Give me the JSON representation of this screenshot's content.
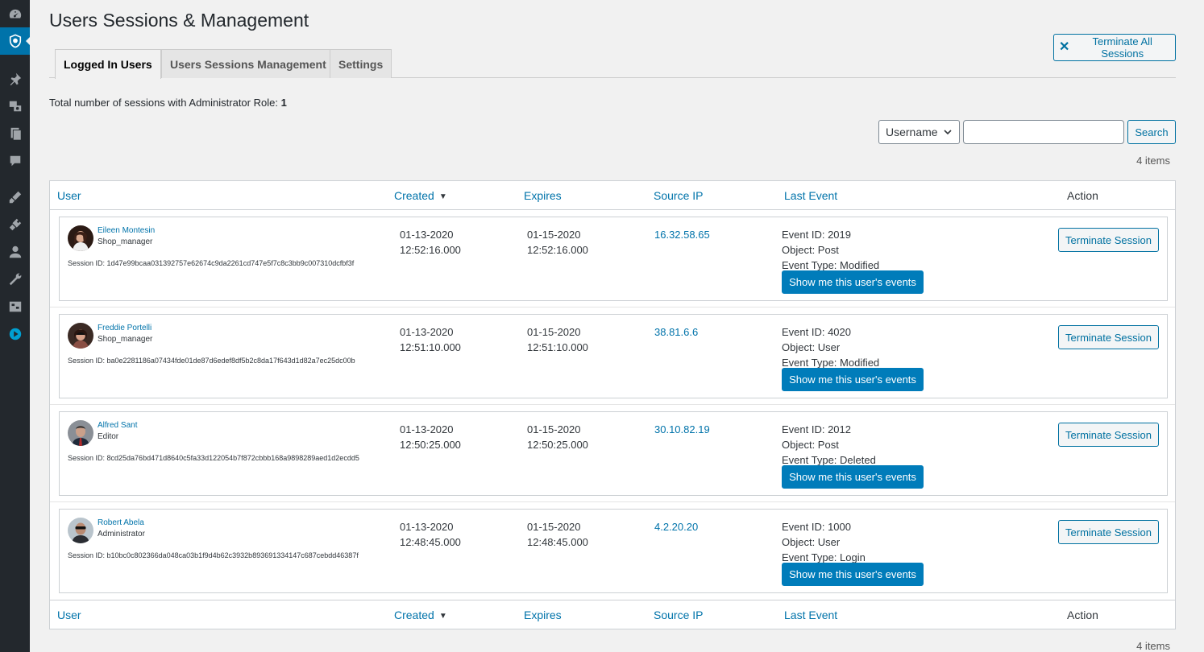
{
  "page": {
    "title": "Users Sessions & Management"
  },
  "header": {
    "terminate_all_label": "Terminate All Sessions"
  },
  "tabs": [
    {
      "label": "Logged In Users",
      "active": true
    },
    {
      "label": "Users Sessions Management",
      "active": false
    },
    {
      "label": "Settings",
      "active": false
    }
  ],
  "summary": {
    "label": "Total number of sessions with Administrator Role:",
    "count": "1"
  },
  "search": {
    "field_selected": "Username",
    "value": "",
    "button_label": "Search"
  },
  "items_count": "4 items",
  "columns": {
    "user": "User",
    "created": "Created",
    "expires": "Expires",
    "source_ip": "Source IP",
    "last_event": "Last Event",
    "action": "Action"
  },
  "rows": [
    {
      "name": "Eileen Montesin",
      "role": "Shop_manager",
      "session": "Session ID: 1d47e99bcaa031392757e62674c9da2261cd747e5f7c8c3bb9c007310dcfbf3f",
      "created_date": "01-13-2020",
      "created_time": "12:52:16.000",
      "expires_date": "01-15-2020",
      "expires_time": "12:52:16.000",
      "ip": "16.32.58.65",
      "event_id": "Event ID: 2019",
      "object": "Object: Post",
      "event_type": "Event Type: Modified",
      "events_button": "Show me this user's events",
      "terminate_button": "Terminate Session"
    },
    {
      "name": "Freddie Portelli",
      "role": "Shop_manager",
      "session": "Session ID: ba0e2281186a07434fde01de87d6edef8df5b2c8da17f643d1d82a7ec25dc00b",
      "created_date": "01-13-2020",
      "created_time": "12:51:10.000",
      "expires_date": "01-15-2020",
      "expires_time": "12:51:10.000",
      "ip": "38.81.6.6",
      "event_id": "Event ID: 4020",
      "object": "Object: User",
      "event_type": "Event Type: Modified",
      "events_button": "Show me this user's events",
      "terminate_button": "Terminate Session"
    },
    {
      "name": "Alfred Sant",
      "role": "Editor",
      "session": "Session ID: 8cd25da76bd471d8640c5fa33d122054b7f872cbbb168a9898289aed1d2ecdd5",
      "created_date": "01-13-2020",
      "created_time": "12:50:25.000",
      "expires_date": "01-15-2020",
      "expires_time": "12:50:25.000",
      "ip": "30.10.82.19",
      "event_id": "Event ID: 2012",
      "object": "Object: Post",
      "event_type": "Event Type: Deleted",
      "events_button": "Show me this user's events",
      "terminate_button": "Terminate Session"
    },
    {
      "name": "Robert Abela",
      "role": "Administrator",
      "session": "Session ID: b10bc0c802366da048ca03b1f9d4b62c3932b893691334147c687cebdd46387f",
      "created_date": "01-13-2020",
      "created_time": "12:48:45.000",
      "expires_date": "01-15-2020",
      "expires_time": "12:48:45.000",
      "ip": "4.2.20.20",
      "event_id": "Event ID: 1000",
      "object": "Object: User",
      "event_type": "Event Type: Login",
      "events_button": "Show me this user's events",
      "terminate_button": "Terminate Session"
    }
  ],
  "colors": {
    "link": "#0073aa",
    "primary_button": "#007cba",
    "sidebar": "#23282d",
    "active_menu": "#0073aa"
  },
  "sidebar_icons": [
    "dashboard-icon",
    "shield-icon",
    "pin-icon",
    "media-icon",
    "pages-icon",
    "comments-icon",
    "appearance-icon",
    "plugins-icon",
    "users-icon",
    "tools-icon",
    "settings-icon",
    "play-icon"
  ]
}
